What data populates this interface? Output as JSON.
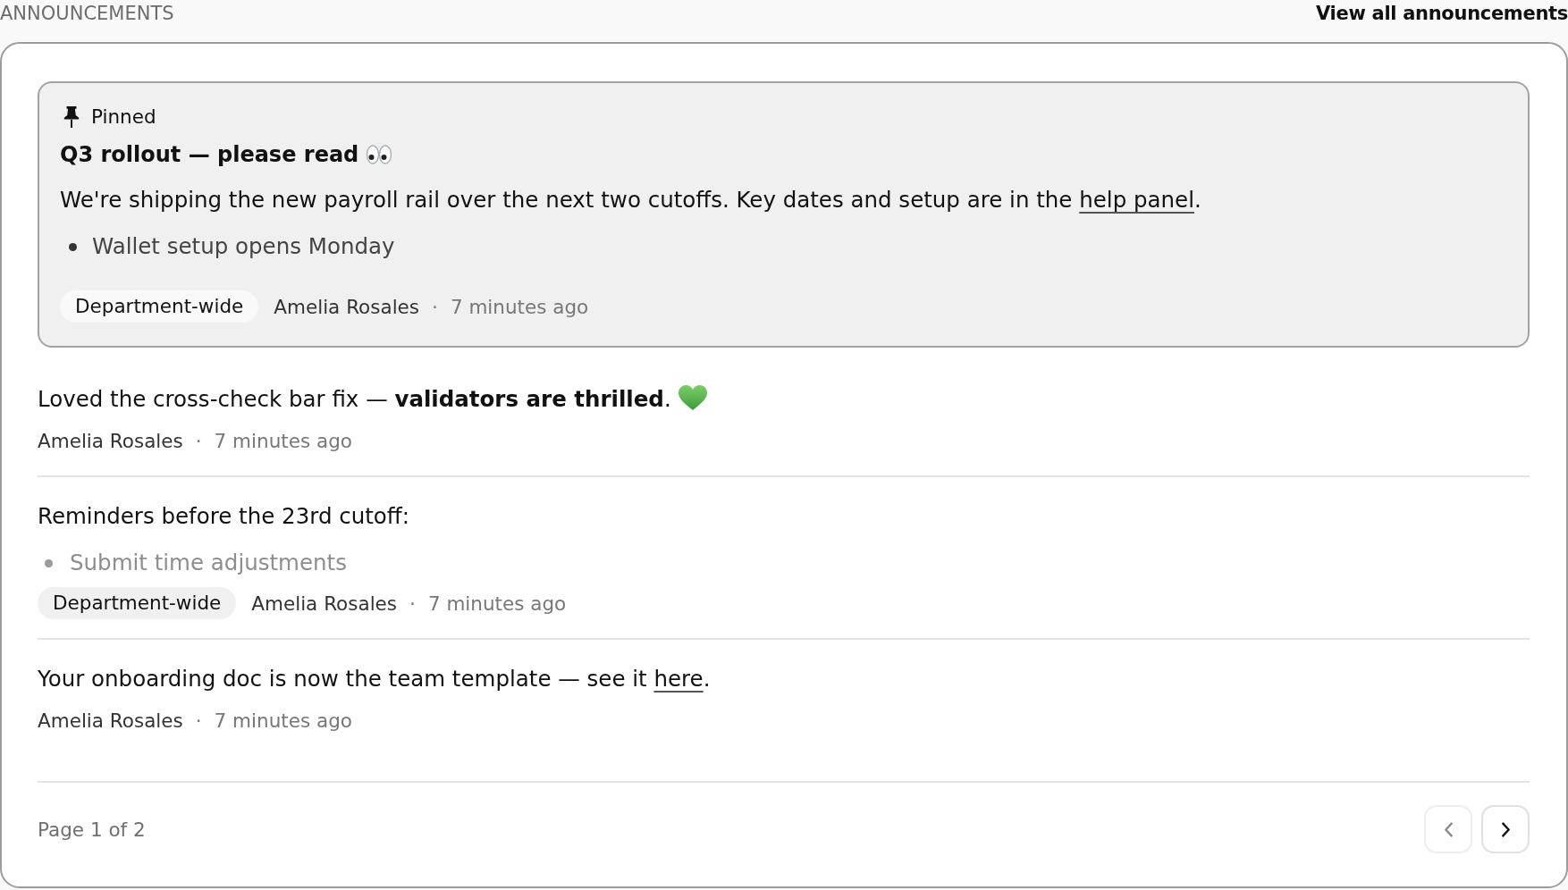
{
  "header": {
    "title": "ANNOUNCEMENTS",
    "link": "View all announcements"
  },
  "pinned": {
    "label": "Pinned",
    "title": [
      {
        "kind": "text",
        "text": "Q3 rollout — please read"
      },
      {
        "kind": "eyes"
      }
    ],
    "body": [
      {
        "kind": "text",
        "text": "We're shipping the new payroll rail over the next two cutoffs. Key dates and setup are in the "
      },
      {
        "kind": "link",
        "text": "help panel"
      },
      {
        "kind": "text",
        "text": "."
      }
    ],
    "bullets": [
      "Wallet setup opens Monday"
    ],
    "meta": {
      "tag": "Department-wide",
      "author": "Amelia Rosales",
      "separator": "·",
      "time": "7 minutes ago"
    }
  },
  "posts": [
    {
      "body": [
        {
          "kind": "text",
          "text": "Loved the cross-check bar fix — **validators are thrilled**."
        },
        {
          "kind": "heart"
        }
      ],
      "meta": {
        "author": "Amelia Rosales",
        "separator": "·",
        "time": "7 minutes ago"
      }
    },
    {
      "body": [
        {
          "kind": "text",
          "text": "Reminders before the 23rd cutoff:"
        }
      ],
      "bullets": [
        "Submit time adjustments"
      ],
      "meta": {
        "tag": "Department-wide",
        "author": "Amelia Rosales",
        "separator": "·",
        "time": "7 minutes ago"
      }
    },
    {
      "body": [
        {
          "kind": "text",
          "text": "Your onboarding doc is now the team template — see it "
        },
        {
          "kind": "link",
          "text": "here"
        },
        {
          "kind": "text",
          "text": "."
        }
      ],
      "meta": {
        "author": "Amelia Rosales",
        "separator": "·",
        "time": "7 minutes ago"
      }
    }
  ],
  "pagination": {
    "label": "Page 1 of 2",
    "prev": {
      "disabled": true
    },
    "next": {
      "disabled": false
    }
  }
}
